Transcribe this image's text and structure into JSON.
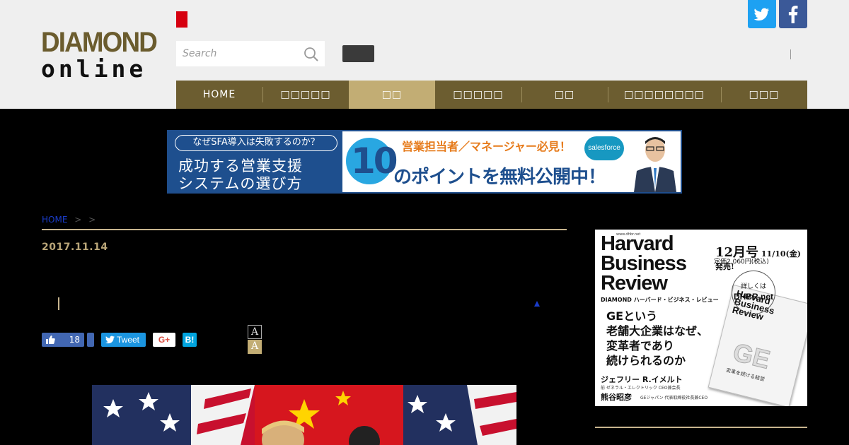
{
  "header": {
    "logo_top": "DIAMOND",
    "logo_bottom": "online",
    "search_placeholder": "Search"
  },
  "nav": {
    "items": [
      {
        "label": "HOME"
      },
      {
        "label": "□□□□□"
      },
      {
        "label": "□□"
      },
      {
        "label": "□□□□□"
      },
      {
        "label": "□□"
      },
      {
        "label": "□□□□□□□□"
      },
      {
        "label": "□□□"
      }
    ],
    "active_index": 2
  },
  "banner": {
    "pill": "なぜSFA導入は失敗するのか？",
    "line1": "成功する営業支援",
    "line2": "システムの選び方",
    "number": "10",
    "top_text": "営業担当者／マネージャー必見！",
    "bottom_text": "のポイントを無料公開中！",
    "brand": "salesforce"
  },
  "article": {
    "breadcrumb_home": "HOME",
    "breadcrumb_sep1": ">",
    "breadcrumb_sep2": ">",
    "date": "2017.11.14",
    "like_count": "18",
    "tweet_label": "Tweet",
    "gplus_label": "G+",
    "hatena_label": "B!",
    "font_small": "A",
    "font_large": "A"
  },
  "sidebar_ad": {
    "url": "www.dhbr.net",
    "title_l1": "Harvard",
    "title_l2": "Business",
    "title_l3": "Review",
    "subtitle": "DIAMOND ハーバード・ビジネス・レビュー",
    "issue_month": "12月号",
    "issue_date": "11/10(金)発売!",
    "price": "定価2,060円(税込)",
    "circle_l1": "詳しくは",
    "circle_l2": "DHBR.net",
    "headline_l1": "GEという",
    "headline_l2": "老舗大企業はなぜ、",
    "headline_l3": "変革者であり",
    "headline_l4": "続けられるのか",
    "author1": "ジェフリー R.イメルト",
    "author1_role": "前 ゼネラル・エレクトリック CEO兼会長",
    "author2": "熊谷昭彦",
    "author2_role": "GEジャパン 代表取締役社長兼CEO",
    "mag_title": "Harvard Business Review",
    "mag_ge": "GE",
    "mag_sub": "変革を続ける経営"
  },
  "colors": {
    "nav_bg": "#6c5d30",
    "nav_active": "#c2ad74",
    "accent_gold": "#c7b48e",
    "twitter": "#1da1f2",
    "facebook": "#3b5998"
  }
}
